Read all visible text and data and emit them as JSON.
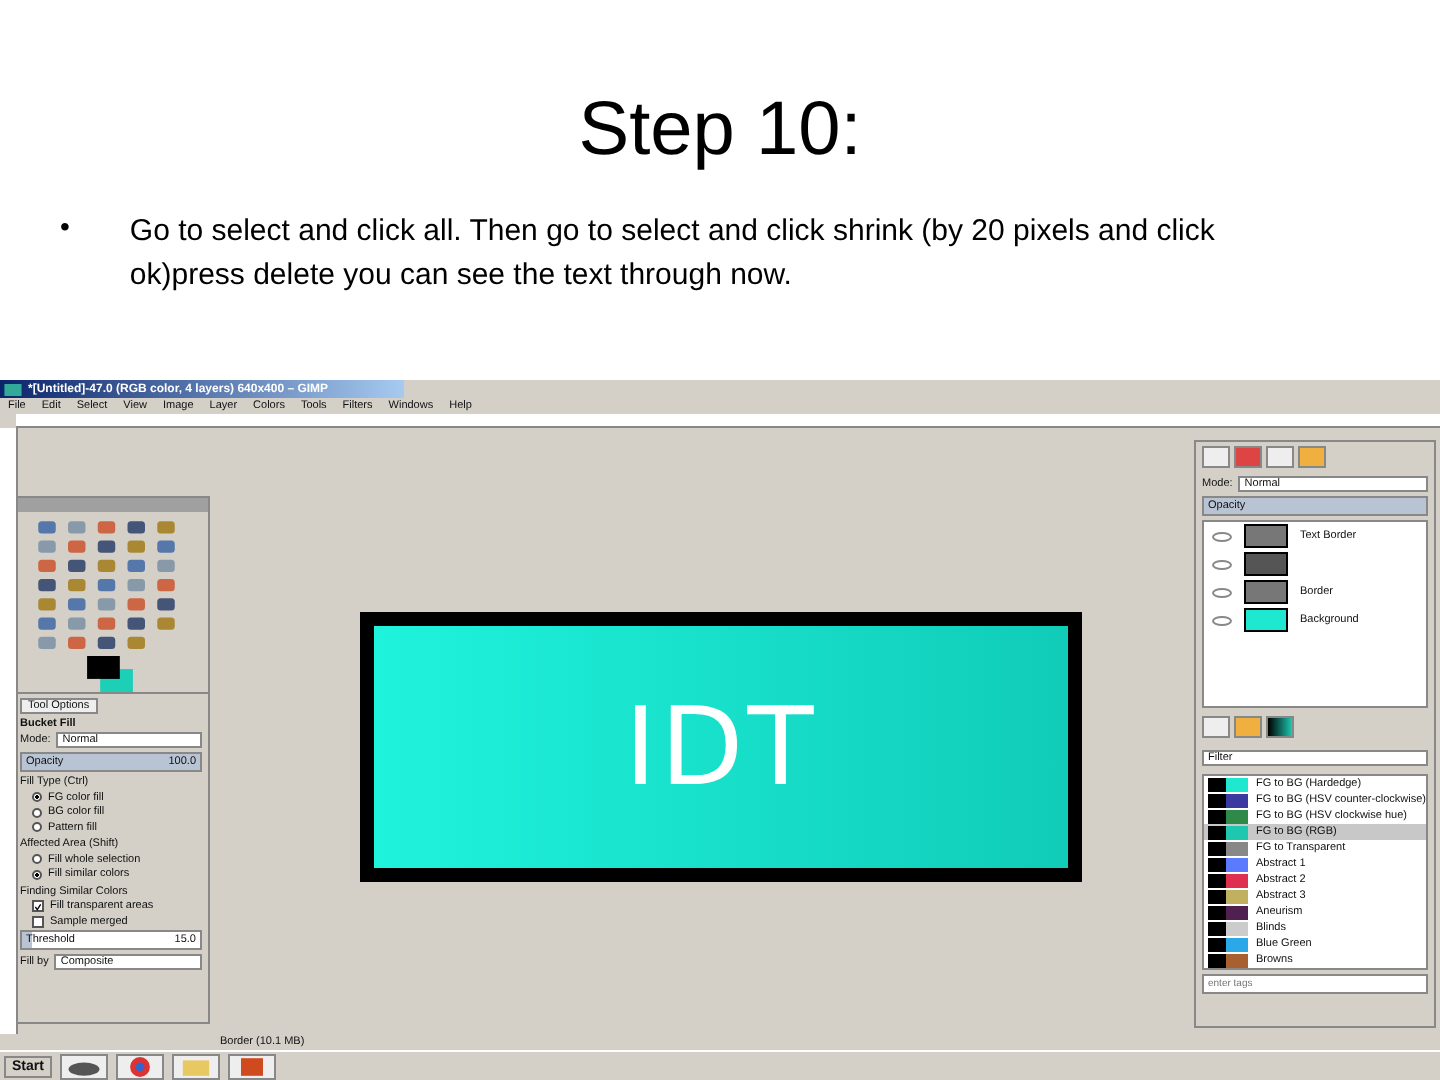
{
  "slide": {
    "title": "Step 10:",
    "bullet": "•",
    "text": "Go to select and click all. Then go to select and click shrink (by 20 pixels and click ok)press delete you can see the text through now."
  },
  "window": {
    "title": "*[Untitled]-47.0 (RGB color, 4 layers) 640x400 – GIMP"
  },
  "menu": [
    "File",
    "Edit",
    "Select",
    "View",
    "Image",
    "Layer",
    "Colors",
    "Tools",
    "Filters",
    "Windows",
    "Help"
  ],
  "image": {
    "text": "IDT"
  },
  "tool_options": {
    "tab": "Tool Options",
    "heading": "Bucket Fill",
    "mode_label": "Mode:",
    "mode": "Normal",
    "opacity_label": "Opacity",
    "opacity": "100.0",
    "level": 1.0,
    "groups": [
      {
        "label": "Fill Type (Ctrl)",
        "options": [
          {
            "label": "FG color fill",
            "selected": true
          },
          {
            "label": "BG color fill",
            "selected": false
          },
          {
            "label": "Pattern fill",
            "selected": false
          }
        ]
      },
      {
        "label": "Affected Area (Shift)",
        "options": [
          {
            "label": "Fill whole selection",
            "selected": false
          },
          {
            "label": "Fill similar colors",
            "selected": true
          }
        ]
      }
    ],
    "similar_label": "Finding Similar Colors",
    "checks": [
      {
        "label": "Fill transparent areas",
        "checked": true
      },
      {
        "label": "Sample merged",
        "checked": false
      }
    ],
    "threshold": {
      "label": "Threshold",
      "value": "15.0",
      "level": 0.06
    },
    "fill_by_label": "Fill by",
    "fill_by": "Composite"
  },
  "layers": {
    "mode_label": "Mode:",
    "mode": "Normal",
    "opacity_label": "Opacity",
    "level": 1.0,
    "items": [
      {
        "name": "Text Border",
        "color": "#777777"
      },
      {
        "color": "#555555"
      },
      {
        "name": "Border",
        "color": "#777777"
      },
      {
        "name": "Background",
        "color": "#1ee8d0"
      }
    ]
  },
  "gradients": {
    "filter": "Filter",
    "tag_placeholder": "enter tags",
    "items": [
      {
        "name": "FG to BG (Hardedge)",
        "color": "#1ee8d0",
        "selected": false
      },
      {
        "name": "FG to BG (HSV counter-clockwise)",
        "color": "#3a3aa0",
        "selected": false
      },
      {
        "name": "FG to BG (HSV clockwise hue)",
        "color": "#2f8a4a",
        "selected": false
      },
      {
        "name": "FG to BG (RGB)",
        "color": "#1ec8b0",
        "selected": true
      },
      {
        "name": "FG to Transparent",
        "color": "#888888",
        "selected": false
      },
      {
        "name": "Abstract 1",
        "color": "#5a7aff",
        "selected": false
      },
      {
        "name": "Abstract 2",
        "color": "#e03050",
        "selected": false
      },
      {
        "name": "Abstract 3",
        "color": "#c0b060",
        "selected": false
      },
      {
        "name": "Aneurism",
        "color": "#502050",
        "selected": false
      },
      {
        "name": "Blinds",
        "color": "#cccccc",
        "selected": false
      },
      {
        "name": "Blue Green",
        "color": "#2aa8e8",
        "selected": false
      },
      {
        "name": "Browns",
        "color": "#a86030",
        "selected": false
      }
    ]
  },
  "status_bar": "Border (10.1 MB)",
  "taskbar": {
    "start": "Start"
  }
}
